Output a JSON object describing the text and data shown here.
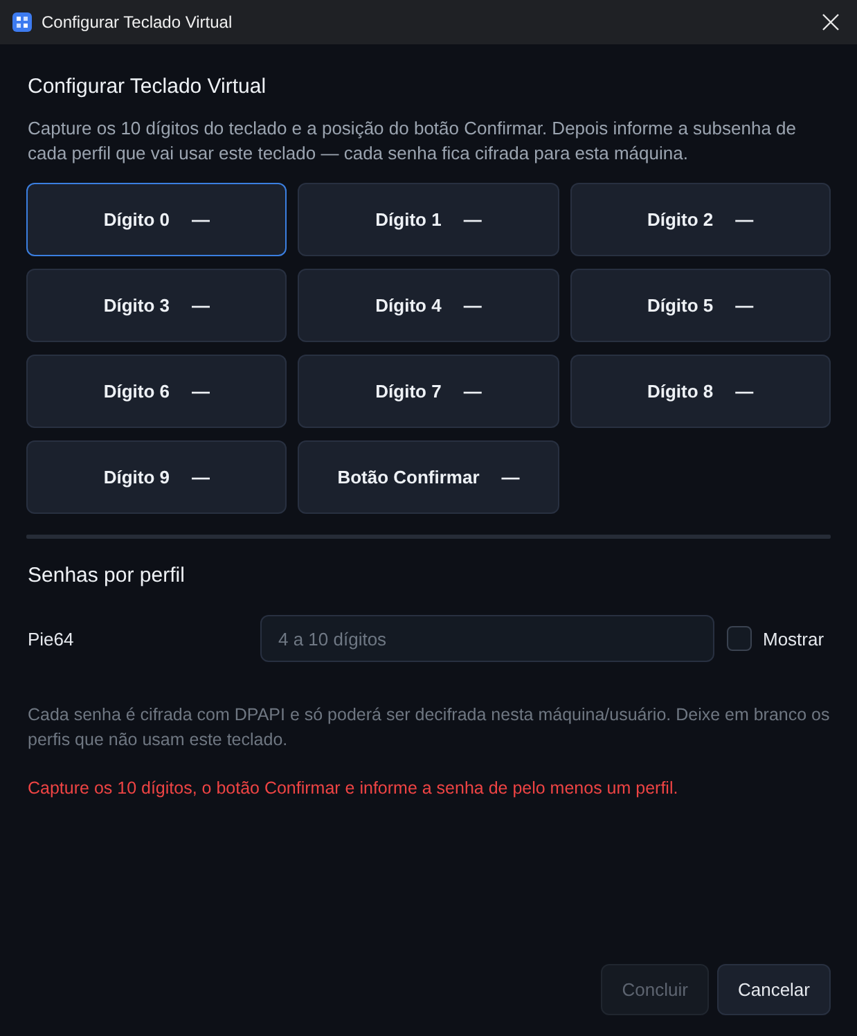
{
  "window": {
    "title": "Configurar Teclado Virtual"
  },
  "heading": "Configurar Teclado Virtual",
  "description": "Capture os 10 dígitos do teclado e a posição do botão Confirmar. Depois informe a subsenha de cada perfil que vai usar este teclado — cada senha fica cifrada para esta máquina.",
  "captures": [
    {
      "label": "Dígito 0",
      "value": "—",
      "selected": true
    },
    {
      "label": "Dígito 1",
      "value": "—",
      "selected": false
    },
    {
      "label": "Dígito 2",
      "value": "—",
      "selected": false
    },
    {
      "label": "Dígito 3",
      "value": "—",
      "selected": false
    },
    {
      "label": "Dígito 4",
      "value": "—",
      "selected": false
    },
    {
      "label": "Dígito 5",
      "value": "—",
      "selected": false
    },
    {
      "label": "Dígito 6",
      "value": "—",
      "selected": false
    },
    {
      "label": "Dígito 7",
      "value": "—",
      "selected": false
    },
    {
      "label": "Dígito 8",
      "value": "—",
      "selected": false
    },
    {
      "label": "Dígito 9",
      "value": "—",
      "selected": false
    },
    {
      "label": "Botão Confirmar",
      "value": "—",
      "selected": false
    }
  ],
  "profiles_section": {
    "title": "Senhas por perfil",
    "profiles": [
      {
        "name": "Pie64",
        "placeholder": "4 a 10 dígitos",
        "show_label": "Mostrar",
        "show_checked": false
      }
    ]
  },
  "note": "Cada senha é cifrada com DPAPI e só poderá ser decifrada nesta máquina/usuário. Deixe em branco os perfis que não usam este teclado.",
  "error": "Capture os 10 dígitos, o botão Confirmar e informe a senha de pelo menos um perfil.",
  "buttons": [
    {
      "label": "Concluir",
      "disabled": true
    },
    {
      "label": "Cancelar",
      "disabled": false
    }
  ]
}
